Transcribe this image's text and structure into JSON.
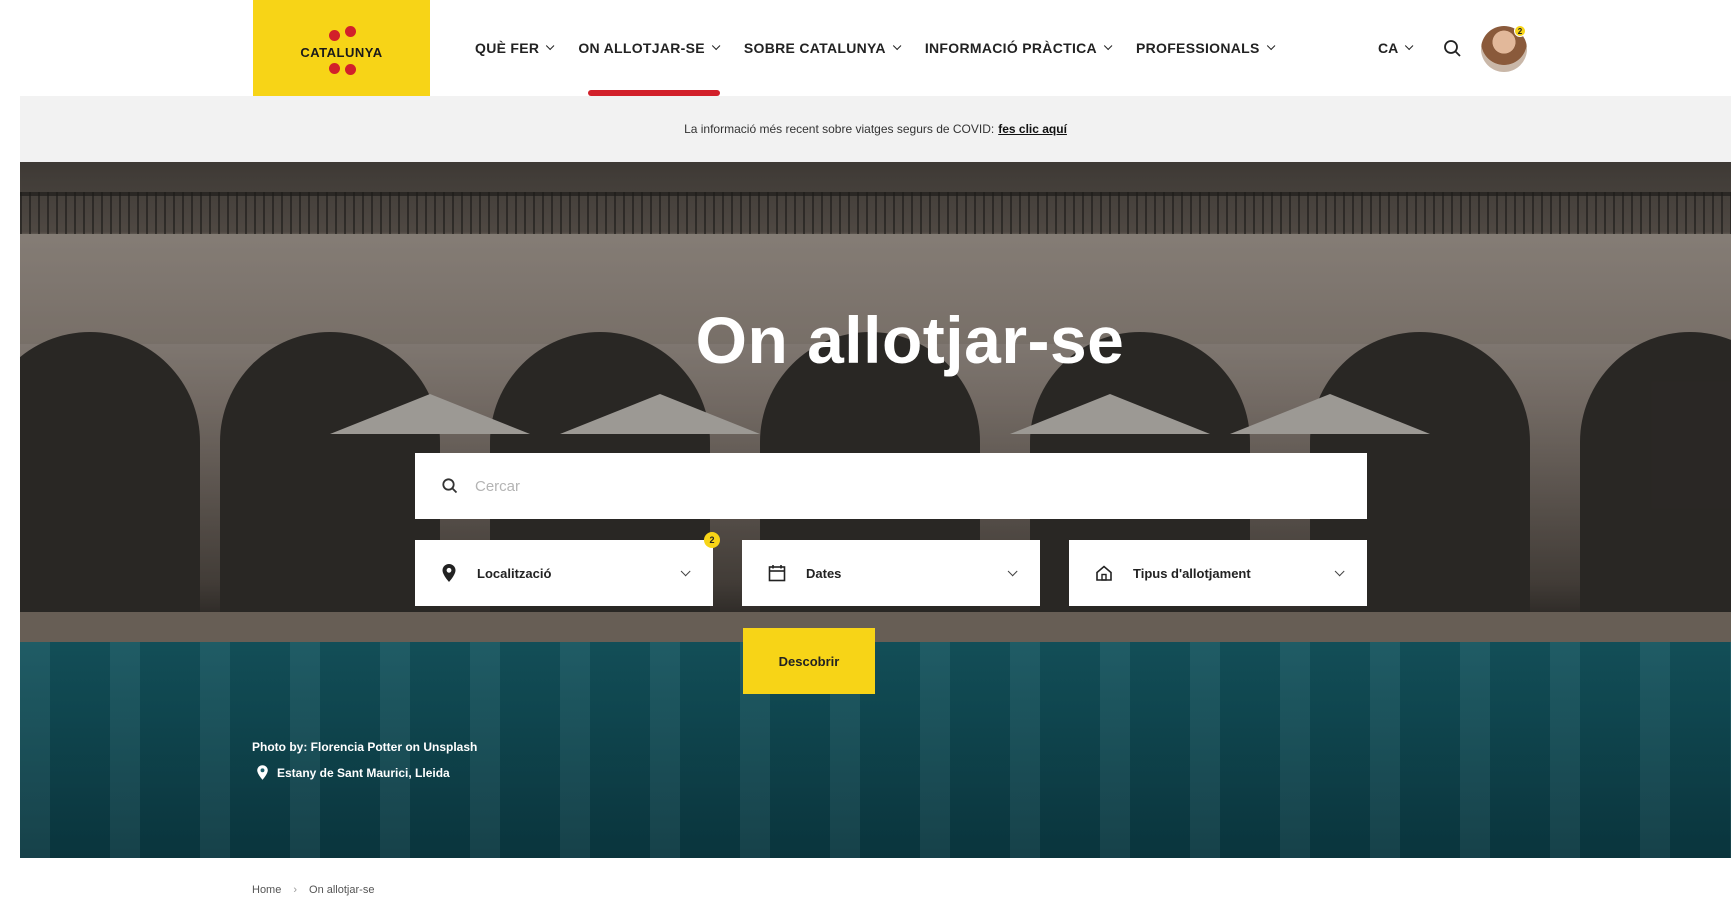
{
  "header": {
    "logo_text": "CATALUNYA",
    "brand_colors": {
      "yellow": "#f7d417",
      "red": "#d2202a"
    },
    "nav": [
      {
        "label": "QUÈ FER",
        "active": false
      },
      {
        "label": "ON ALLOTJAR-SE",
        "active": true
      },
      {
        "label": "SOBRE CATALUNYA",
        "active": false
      },
      {
        "label": "INFORMACIÓ PRÀCTICA",
        "active": false
      },
      {
        "label": "PROFESSIONALS",
        "active": false
      }
    ],
    "language": "CA",
    "search_icon": "search-icon",
    "avatar_badge": "2"
  },
  "banner": {
    "text": "La informació més recent sobre viatges segurs de COVID:",
    "link": "fes clic aquí"
  },
  "hero": {
    "title": "On allotjar-se",
    "search_placeholder": "Cercar",
    "filters": [
      {
        "label": "Localització",
        "icon": "map-pin-icon"
      },
      {
        "label": "Dates",
        "icon": "calendar-icon"
      },
      {
        "label": "Tipus d'allotjament",
        "icon": "home-icon"
      }
    ],
    "filter_badge": "2",
    "discover_label": "Descobrir",
    "photo_credit": "Photo by: Florencia Potter on Unsplash",
    "location": "Estany de Sant Maurici, Lleida"
  },
  "breadcrumb": {
    "home": "Home",
    "current": "On allotjar-se"
  }
}
